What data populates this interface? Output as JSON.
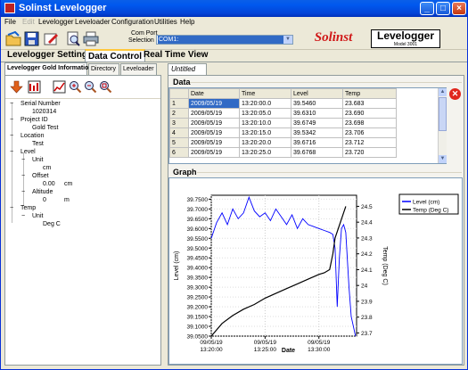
{
  "window": {
    "title": "Solinst Levelogger"
  },
  "menu": [
    "File",
    "Edit",
    "Levelogger",
    "Leveloader",
    "Configuration",
    "Utilities",
    "Help"
  ],
  "menu_disabled": [
    false,
    true,
    false,
    false,
    false,
    false,
    false
  ],
  "toolbar": {
    "com_label1": "Com Port",
    "com_label2": "Selection",
    "com_value": "COM1:",
    "brand": "Solinst",
    "brand2": "Levelogger",
    "brand2_sub": "Model 3001"
  },
  "tabs": [
    "Levelogger Setting",
    "Data Control",
    "Real Time View"
  ],
  "subtabs": [
    "Levelogger Gold Information",
    "Directory",
    "Leveloader"
  ],
  "doc_tab": "Untitled",
  "tree": {
    "serial_label": "Serial Number",
    "serial_value": "1020314",
    "project_label": "Project ID",
    "project_value": "Gold Test",
    "location_label": "Location",
    "location_value": "Test",
    "level_label": "Level",
    "unit_label": "Unit",
    "unit_value": "cm",
    "offset_label": "Offset",
    "offset_value": "0.00",
    "offset_unit": "cm",
    "altitude_label": "Altitude",
    "altitude_value": "0",
    "altitude_unit": "m",
    "temp_label": "Temp",
    "temp_unit_label": "Unit",
    "temp_unit_value": "Deg C"
  },
  "data_section": {
    "label": "Data",
    "columns": [
      "Date",
      "Time",
      "Level",
      "Temp"
    ],
    "rows": [
      [
        "1",
        "2009/05/19",
        "13:20:00.0",
        "39.5460",
        "23.683"
      ],
      [
        "2",
        "2009/05/19",
        "13:20:05.0",
        "39.6310",
        "23.690"
      ],
      [
        "3",
        "2009/05/19",
        "13:20:10.0",
        "39.6749",
        "23.698"
      ],
      [
        "4",
        "2009/05/19",
        "13:20:15.0",
        "39.5342",
        "23.706"
      ],
      [
        "5",
        "2009/05/19",
        "13:20:20.0",
        "39.6716",
        "23.712"
      ],
      [
        "6",
        "2009/05/19",
        "13:20:25.0",
        "39.6768",
        "23.720"
      ]
    ]
  },
  "graph_section": {
    "label": "Graph"
  },
  "colors": {
    "level": "#0000ff",
    "temp": "#000000",
    "selection": "#316ac5",
    "title_bar": "#0054e3"
  },
  "chart_data": {
    "type": "line",
    "xlabel": "Date",
    "ylabel": "Level (cm)",
    "y2label": "Temp (Deg C)",
    "ylim": [
      39.05,
      39.77
    ],
    "y2lim": [
      23.68,
      24.57
    ],
    "yticks": [
      "39.7500",
      "39.7000",
      "39.6500",
      "39.6000",
      "39.5500",
      "39.5000",
      "39.4500",
      "39.4000",
      "39.3500",
      "39.3000",
      "39.2500",
      "39.2000",
      "39.1500",
      "39.1000",
      "39.0500"
    ],
    "y2ticks": [
      "24.5",
      "24.4",
      "24.3",
      "24.2",
      "24.1",
      "24",
      "23.9",
      "23.8",
      "23.7"
    ],
    "xticks": [
      {
        "d": "09/05/19",
        "t": "13:20:00"
      },
      {
        "d": "09/05/19",
        "t": "13:25:00"
      },
      {
        "d": "09/05/19",
        "t": "13:30:00"
      }
    ],
    "xrange_min": [
      0,
      13.5
    ],
    "xtick_min": [
      0,
      5,
      10
    ],
    "legend": [
      "Level (cm)",
      "Temp (Deg C)"
    ],
    "legend_position": "top-right",
    "grid": true,
    "series": [
      {
        "name": "Level (cm)",
        "color": "#0000ff",
        "x": [
          0,
          0.5,
          1,
          1.5,
          2,
          2.5,
          3,
          3.5,
          4,
          4.5,
          5,
          5.5,
          6,
          6.5,
          7,
          7.5,
          8,
          8.5,
          9,
          9.5,
          10,
          10.5,
          11,
          11.3,
          11.5,
          11.7,
          11.9,
          12.1,
          12.3,
          12.5,
          12.8,
          13,
          13.2,
          13.4
        ],
        "y": [
          39.55,
          39.63,
          39.68,
          39.62,
          39.7,
          39.65,
          39.68,
          39.76,
          39.69,
          39.66,
          39.68,
          39.64,
          39.7,
          39.66,
          39.62,
          39.67,
          39.6,
          39.65,
          39.62,
          39.61,
          39.6,
          39.59,
          39.58,
          39.57,
          39.5,
          39.2,
          39.45,
          39.6,
          39.62,
          39.58,
          39.3,
          39.15,
          39.1,
          39.05
        ]
      },
      {
        "name": "Temp (Deg C)",
        "color": "#000000",
        "x": [
          0,
          1,
          2,
          3,
          4,
          5,
          6,
          7,
          8,
          9,
          10,
          10.5,
          11,
          11.3,
          11.5,
          12,
          12.5
        ],
        "y": [
          23.68,
          23.76,
          23.81,
          23.85,
          23.88,
          23.92,
          23.95,
          23.98,
          24.01,
          24.04,
          24.07,
          24.08,
          24.1,
          24.2,
          24.3,
          24.4,
          24.5
        ]
      }
    ]
  }
}
